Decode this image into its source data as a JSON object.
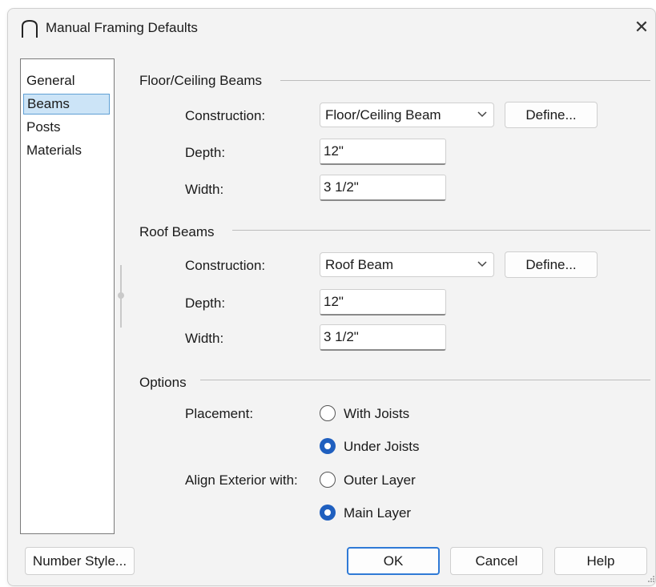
{
  "window": {
    "title": "Manual Framing Defaults",
    "close_glyph": "✕",
    "app_icon": "arch-icon"
  },
  "sidebar": {
    "items": [
      {
        "label": "General",
        "selected": false
      },
      {
        "label": "Beams",
        "selected": true
      },
      {
        "label": "Posts",
        "selected": false
      },
      {
        "label": "Materials",
        "selected": false
      }
    ]
  },
  "floor_ceiling_beams": {
    "heading": "Floor/Ceiling Beams",
    "construction_label": "Construction:",
    "construction_value": "Floor/Ceiling Beam",
    "define_label": "Define...",
    "depth_label": "Depth:",
    "depth_value": "12\"",
    "width_label": "Width:",
    "width_value": "3 1/2\""
  },
  "roof_beams": {
    "heading": "Roof Beams",
    "construction_label": "Construction:",
    "construction_value": "Roof Beam",
    "define_label": "Define...",
    "depth_label": "Depth:",
    "depth_value": "12\"",
    "width_label": "Width:",
    "width_value": "3 1/2\""
  },
  "options": {
    "heading": "Options",
    "placement_label": "Placement:",
    "placement_choices": [
      {
        "label": "With Joists",
        "checked": false
      },
      {
        "label": "Under Joists",
        "checked": true
      }
    ],
    "align_label": "Align Exterior with:",
    "align_choices": [
      {
        "label": "Outer Layer",
        "checked": false
      },
      {
        "label": "Main Layer",
        "checked": true
      }
    ]
  },
  "footer": {
    "number_style_label": "Number Style...",
    "ok_label": "OK",
    "cancel_label": "Cancel",
    "help_label": "Help"
  },
  "colors": {
    "accent": "#2f7ad6",
    "radio_selected": "#1f5fbf",
    "selection_bg": "#cce4f7",
    "dialog_bg": "#f3f3f3"
  }
}
